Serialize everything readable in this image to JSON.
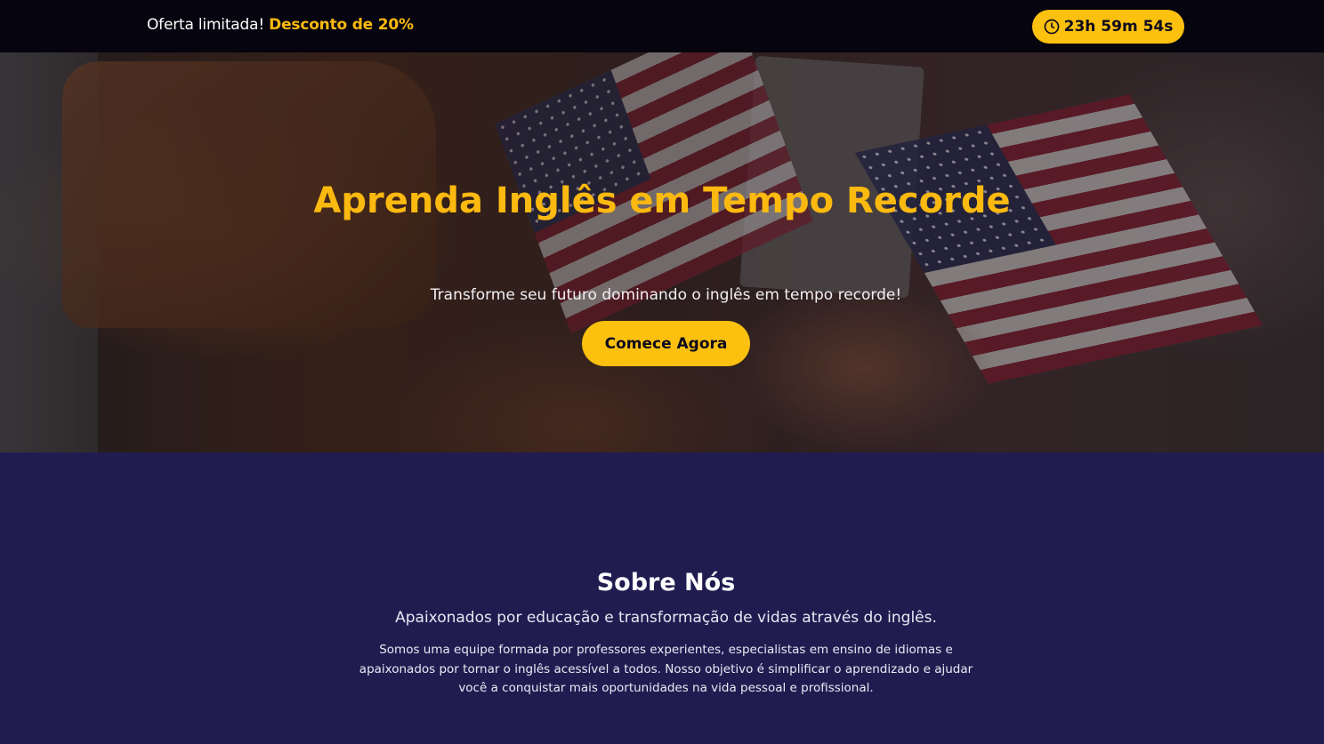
{
  "topbar": {
    "offer_label": "Oferta limitada!",
    "offer_discount": "Desconto de 20%",
    "timer_icon": "clock-icon",
    "timer_text": "23h 59m 54s"
  },
  "hero": {
    "title": "Aprenda Inglês em Tempo Recorde",
    "subtitle": "Transforme seu futuro dominando o inglês em tempo recorde!",
    "cta_label": "Comece Agora"
  },
  "about": {
    "title": "Sobre Nós",
    "subtitle": "Apaixonados por educação e transformação de vidas através do inglês.",
    "text": "Somos uma equipe formada por professores experientes, especialistas em ensino de idiomas e apaixonados por tornar o inglês acessível a todos. Nosso objetivo é simplificar o aprendizado e ajudar você a conquistar mais oportunidades na vida pessoal e profissional."
  },
  "colors": {
    "accent": "#fcc00f",
    "topbar_bg": "#05040f",
    "section_bg": "#211c50"
  }
}
